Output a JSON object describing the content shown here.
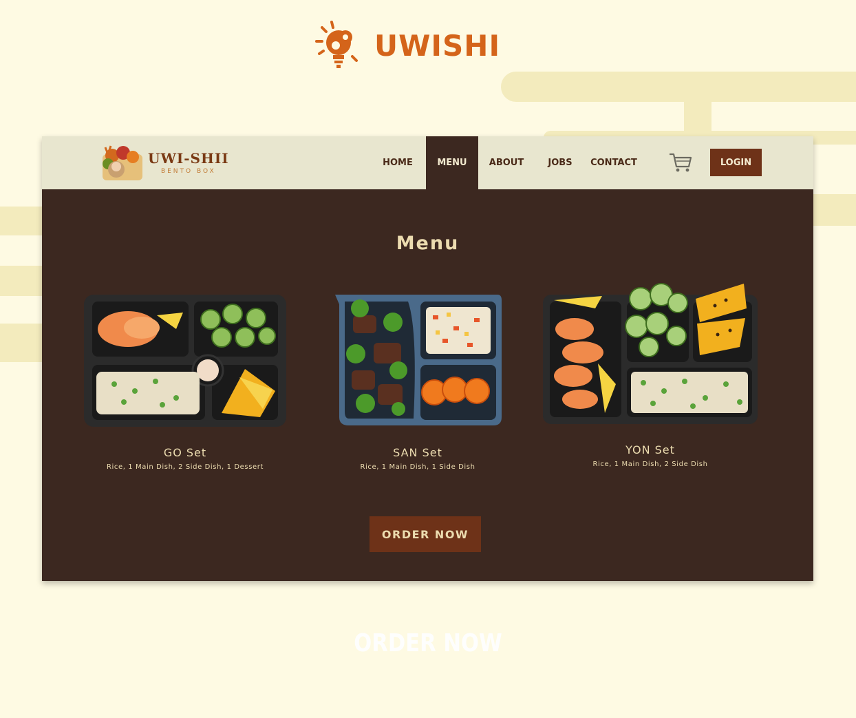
{
  "brand": {
    "name": "UWISHI",
    "icon": "lightbulb-gear-icon",
    "color": "#d4641a"
  },
  "site": {
    "logo": {
      "title": "UWI-SHII",
      "subtitle": "BENTO BOX"
    },
    "nav": [
      {
        "label": "HOME",
        "active": false
      },
      {
        "label": "MENU",
        "active": true
      },
      {
        "label": "ABOUT",
        "active": false
      },
      {
        "label": "JOBS",
        "active": false
      },
      {
        "label": "CONTACT",
        "active": false
      }
    ],
    "cart_icon": "cart-icon",
    "login_label": "LOGIN",
    "colors": {
      "nav_bg": "#e8e6cf",
      "body_bg": "#3c2820",
      "accent": "#6e3218",
      "text": "#ecdcb0"
    }
  },
  "menu": {
    "title": "Menu",
    "items": [
      {
        "name": "GO Set",
        "description": "Rice, 1 Main Dish, 2 Side Dish, 1 Dessert"
      },
      {
        "name": "SAN Set",
        "description": "Rice, 1 Main Dish, 1 Side Dish"
      },
      {
        "name": "YON Set",
        "description": "Rice, 1 Main Dish, 2 Side Dish"
      }
    ],
    "order_label": "ORDER NOW"
  },
  "footer_text": "ORDER NOW"
}
